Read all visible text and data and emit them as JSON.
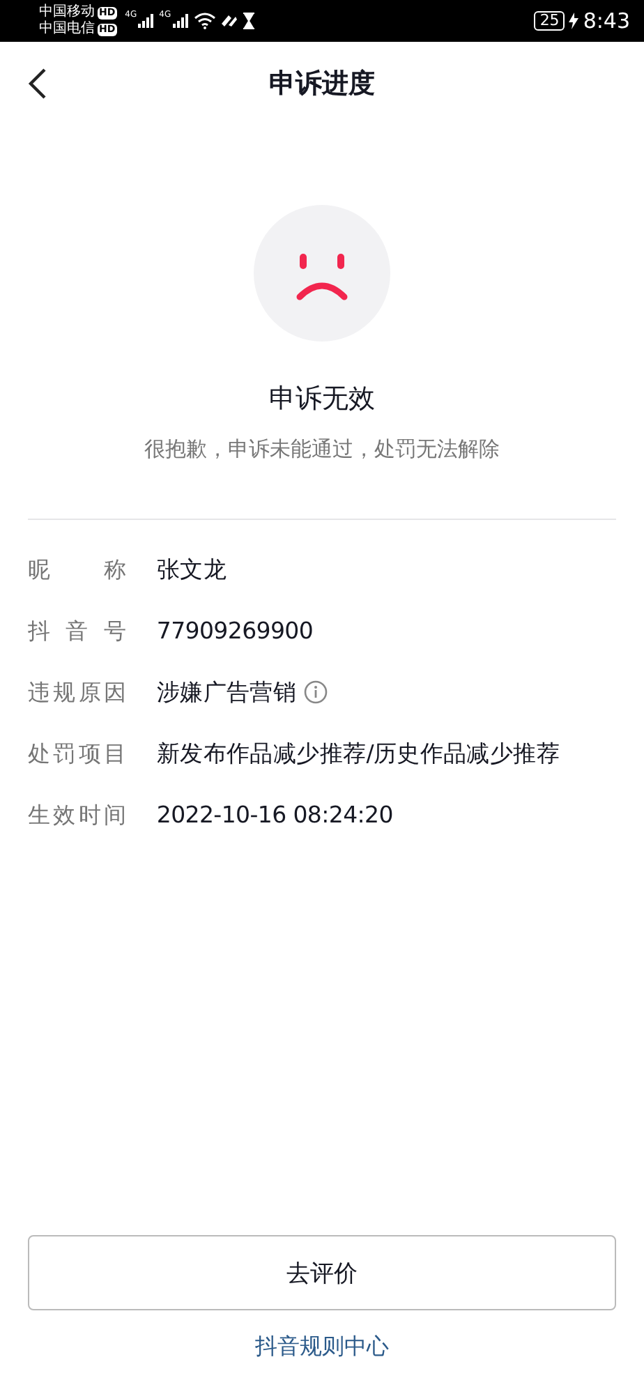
{
  "status_bar": {
    "carriers": [
      {
        "name": "中国移动",
        "badge": "HD"
      },
      {
        "name": "中国电信",
        "badge": "HD"
      }
    ],
    "networks": [
      "4G",
      "4G"
    ],
    "battery": "25",
    "time": "8:43"
  },
  "header": {
    "title": "申诉进度"
  },
  "result": {
    "title": "申诉无效",
    "message": "很抱歉，申诉未能通过，处罚无法解除"
  },
  "details": [
    {
      "label": "昵称",
      "value": "张文龙",
      "info": false
    },
    {
      "label": "抖音号",
      "value": "77909269900",
      "info": false
    },
    {
      "label": "违规原因",
      "value": "涉嫌广告营销",
      "info": true
    },
    {
      "label": "处罚项目",
      "value": "新发布作品减少推荐/历史作品减少推荐",
      "info": false
    },
    {
      "label": "生效时间",
      "value": "2022-10-16 08:24:20",
      "info": false
    }
  ],
  "primary_button": "去评价",
  "footer_link": "抖音规则中心"
}
